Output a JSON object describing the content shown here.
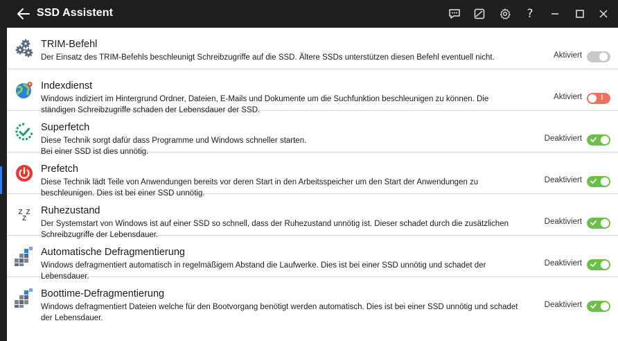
{
  "window": {
    "title": "SSD Assistent",
    "toolbar_icons": [
      "back-arrow-icon",
      "feedback-icon",
      "theme-icon",
      "gear-icon",
      "help-icon",
      "minimize-icon",
      "maximize-icon",
      "close-icon"
    ],
    "help_glyph": "?"
  },
  "colors": {
    "titlebar": "#1f1f1f",
    "toggle_on": "#6cc04a",
    "toggle_off": "#c8c8c8",
    "toggle_warn": "#f0705f",
    "accent": "#2d7ff9"
  },
  "settings": [
    {
      "title": "TRIM-Befehl",
      "description": "Der Einsatz des TRIM-Befehls beschleunigt Schreibzugriffe auf die SSD. Ältere SSDs unterstützen diesen Befehl eventuell nicht.",
      "status": "Aktiviert",
      "toggle": "off",
      "icon": "gears-icon"
    },
    {
      "title": "Indexdienst",
      "description": "Windows indiziert im Hintergrund Ordner, Dateien, E-Mails und Dokumente um die Suchfunktion beschleunigen zu können. Die ständigen Schreibzugriffe schaden der Lebensdauer der SSD.",
      "status": "Aktiviert",
      "toggle": "warning",
      "icon": "globe-pin-icon"
    },
    {
      "title": "Superfetch",
      "description": "Diese Technik sorgt dafür dass Programme und Windows schneller starten.\nBei einer SSD ist dies unnötig.",
      "status": "Deaktiviert",
      "toggle": "on",
      "icon": "refresh-check-icon"
    },
    {
      "title": "Prefetch",
      "description": "Diese Technik lädt Teile von Anwendungen bereits vor deren Start in den Arbeitsspeicher um den Start der Anwendungen zu beschleunigen. Dies ist bei einer SSD unnötig.",
      "status": "Deaktiviert",
      "toggle": "on",
      "icon": "power-icon"
    },
    {
      "title": "Ruhezustand",
      "description": "Der Systemstart von Windows ist auf einer SSD so schnell, dass der Ruhezustand unnötig ist. Dieser schadet durch die zusätzlichen Schreibzugriffe der Lebensdauer.",
      "status": "Deaktiviert",
      "toggle": "on",
      "icon": "sleep-icon",
      "icon_glyph": "Z Z Z"
    },
    {
      "title": "Automatische Defragmentierung",
      "description": "Windows defragmentiert automatisch in regelmäßigem Abstand die Laufwerke. Dies ist bei einer SSD unnötig und schadet der Lebensdauer.",
      "status": "Deaktiviert",
      "toggle": "on",
      "icon": "defrag-icon"
    },
    {
      "title": "Boottime-Defragmentierung",
      "description": "Windows defragmentiert Dateien welche für den Bootvorgang benötigt werden automatisch. Dies ist bei einer SSD unnötig und schadet der Lebensdauer.",
      "status": "Deaktiviert",
      "toggle": "on",
      "icon": "defrag-icon"
    }
  ]
}
